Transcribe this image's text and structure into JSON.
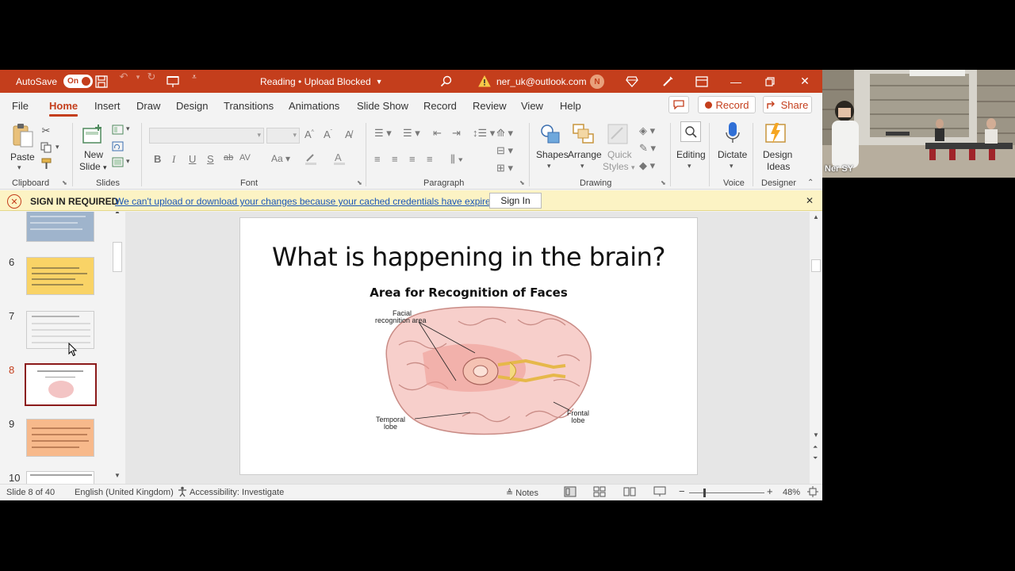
{
  "titlebar": {
    "autosave_label": "AutoSave",
    "autosave_state": "On",
    "doc_name": "Reading • Upload Blocked",
    "user_email": "ner_uk@outlook.com",
    "user_initial": "N"
  },
  "tabs": [
    "File",
    "Home",
    "Insert",
    "Draw",
    "Design",
    "Transitions",
    "Animations",
    "Slide Show",
    "Record",
    "Review",
    "View",
    "Help"
  ],
  "tab_buttons": {
    "record": "Record",
    "share": "Share"
  },
  "ribbon": {
    "clipboard": {
      "label": "Clipboard",
      "paste": "Paste"
    },
    "slides": {
      "label": "Slides",
      "new_slide_line1": "New",
      "new_slide_line2": "Slide"
    },
    "font": {
      "label": "Font"
    },
    "paragraph": {
      "label": "Paragraph"
    },
    "drawing": {
      "label": "Drawing",
      "shapes": "Shapes",
      "arrange": "Arrange",
      "quick_styles_line1": "Quick",
      "quick_styles_line2": "Styles"
    },
    "editing": {
      "label": "Editing"
    },
    "voice": {
      "label": "Voice",
      "dictate": "Dictate"
    },
    "designer": {
      "label": "Designer",
      "design_ideas_line1": "Design",
      "design_ideas_line2": "Ideas"
    }
  },
  "notification": {
    "title": "SIGN IN REQUIRED",
    "message": "We can't upload or download your changes because your cached credentials have expired.",
    "button": "Sign In"
  },
  "thumbnails": [
    {
      "num": "6"
    },
    {
      "num": "7"
    },
    {
      "num": "8"
    },
    {
      "num": "9"
    },
    {
      "num": "10"
    }
  ],
  "slide": {
    "title": "What is happening in the brain?",
    "subtitle": "Area for Recognition of Faces",
    "labels": {
      "facial1": "Facial",
      "facial2": "recognition area",
      "temporal1": "Temporal",
      "temporal2": "lobe",
      "frontal1": "Frontal",
      "frontal2": "lobe"
    }
  },
  "status": {
    "slide_info": "Slide 8 of 40",
    "language": "English (United Kingdom)",
    "accessibility": "Accessibility: Investigate",
    "notes": "Notes",
    "zoom": "48%"
  },
  "video": {
    "participant": "Ner SY"
  },
  "colors": {
    "accent": "#c43e1c",
    "notification_bg": "#fcf3c4",
    "link": "#1a56b6"
  }
}
